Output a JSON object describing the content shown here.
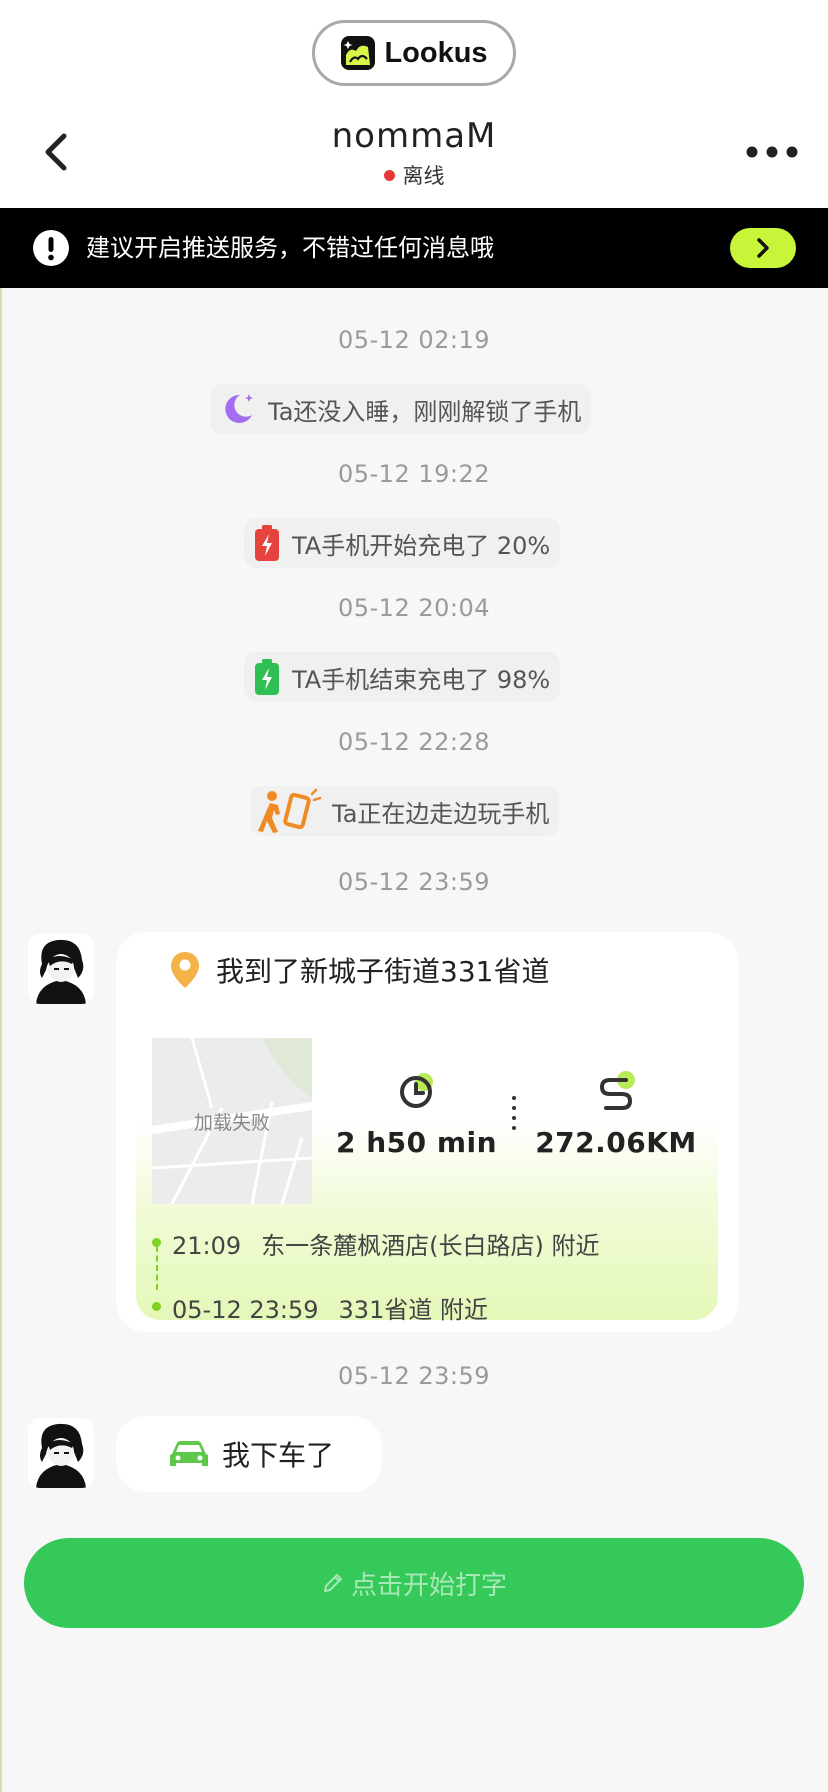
{
  "header": {
    "brand": "Lookus",
    "title": "nommaM",
    "status": "离线",
    "status_color": "#e53935",
    "icons": {
      "back": "chevron-left-icon",
      "more": "more-horizontal-icon"
    }
  },
  "banner": {
    "text": "建议开启推送服务，不错过任何消息哦",
    "action_icon": "chevron-right-icon",
    "accent": "#c7f53a"
  },
  "feed": [
    {
      "timestamp": "05-12 02:19",
      "event": "Ta还没入睡，刚刚解锁了手机",
      "icon": "moon-icon"
    },
    {
      "timestamp": "05-12 19:22",
      "event": "TA手机开始充电了 20%",
      "icon": "battery-low-charging-icon"
    },
    {
      "timestamp": "05-12 20:04",
      "event": "TA手机结束充电了 98%",
      "icon": "battery-full-charging-icon"
    },
    {
      "timestamp": "05-12 22:28",
      "event": "Ta正在边走边玩手机",
      "icon": "walking-phone-icon"
    }
  ],
  "location_message": {
    "timestamp": "05-12 23:59",
    "title": "我到了新城子街道331省道",
    "map_fallback": "加载失败",
    "duration": "2 h50 min",
    "distance": "272.06KM",
    "route": [
      {
        "time": "21:09",
        "place": "东一条麓枫酒店(长白路店) 附近"
      },
      {
        "time": "05-12 23:59",
        "place": "331省道 附近"
      }
    ]
  },
  "car_message": {
    "timestamp": "05-12 23:59",
    "text": "我下车了",
    "icon": "car-icon"
  },
  "input": {
    "placeholder": "点击开始打字",
    "button_color": "#35c95a"
  }
}
